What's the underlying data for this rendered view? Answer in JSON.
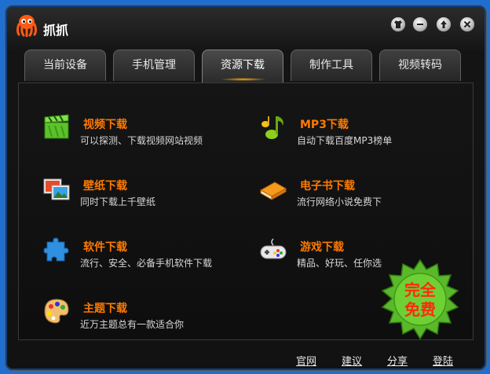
{
  "app": {
    "title": "抓抓"
  },
  "tabs": [
    {
      "label": "当前设备",
      "active": false
    },
    {
      "label": "手机管理",
      "active": false
    },
    {
      "label": "资源下载",
      "active": true
    },
    {
      "label": "制作工具",
      "active": false
    },
    {
      "label": "视频转码",
      "active": false
    }
  ],
  "downloads": [
    {
      "title": "视频下载",
      "desc": "可以探测、下载视频网站视频",
      "icon": "video-clapper-icon"
    },
    {
      "title": "MP3下载",
      "desc": "自动下载百度MP3榜单",
      "icon": "music-note-icon"
    },
    {
      "title": "壁纸下载",
      "desc": "同时下载上千壁纸",
      "icon": "wallpaper-icon"
    },
    {
      "title": "电子书下载",
      "desc": "流行网络小说免费下",
      "icon": "book-icon"
    },
    {
      "title": "软件下载",
      "desc": "流行、安全、必备手机软件下载",
      "icon": "puzzle-icon"
    },
    {
      "title": "游戏下载",
      "desc": "精品、好玩、任你选",
      "icon": "gamepad-icon"
    },
    {
      "title": "主题下载",
      "desc": "近万主题总有一款适合你",
      "icon": "palette-icon"
    }
  ],
  "badge": {
    "line1": "完全",
    "line2": "免费"
  },
  "footer": {
    "links": [
      "官网",
      "建议",
      "分享",
      "登陆"
    ]
  },
  "colors": {
    "accent": "#ff7a00",
    "background": "#121212",
    "desktop": "#1f6fd0"
  }
}
